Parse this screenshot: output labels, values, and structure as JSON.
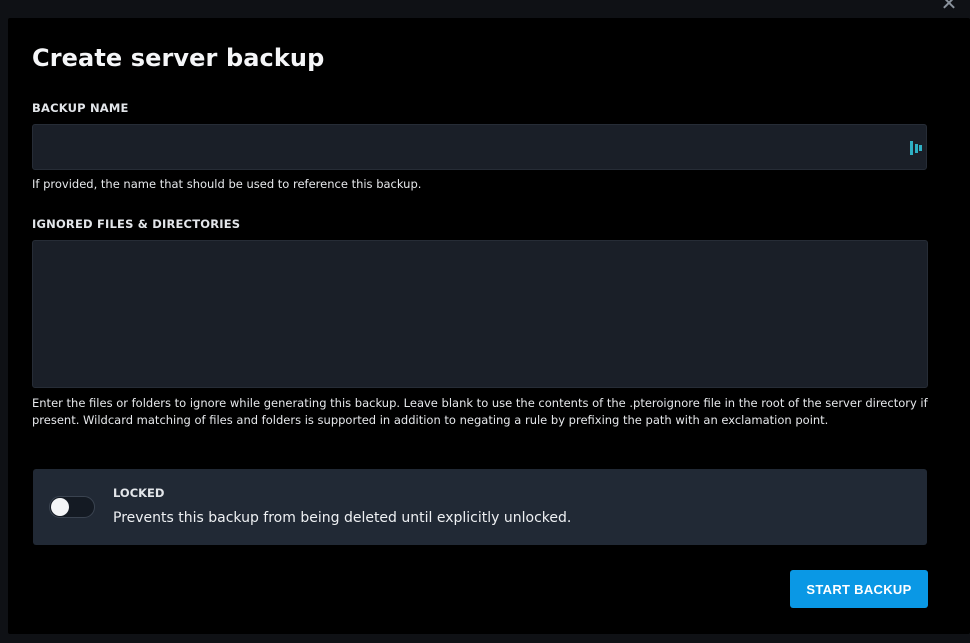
{
  "modal": {
    "title": "Create server backup",
    "close_icon": "close-icon"
  },
  "backup_name": {
    "label": "BACKUP NAME",
    "value": "",
    "placeholder": "",
    "helper": "If provided, the name that should be used to reference this backup.",
    "autofill_icon": "password-manager-icon"
  },
  "ignored_files": {
    "label": "IGNORED FILES & DIRECTORIES",
    "value": "",
    "helper": "Enter the files or folders to ignore while generating this backup. Leave blank to use the contents of the .pteroignore file in the root of the server directory if present. Wildcard matching of files and folders is supported in addition to negating a rule by prefixing the path with an exclamation point."
  },
  "locked": {
    "title": "LOCKED",
    "description": "Prevents this backup from being deleted until explicitly unlocked.",
    "enabled": false
  },
  "actions": {
    "start_label": "START BACKUP"
  },
  "colors": {
    "accent": "#0a98e5",
    "modal_bg": "#000000",
    "input_bg": "#1a1f28",
    "panel_bg": "#212935"
  }
}
